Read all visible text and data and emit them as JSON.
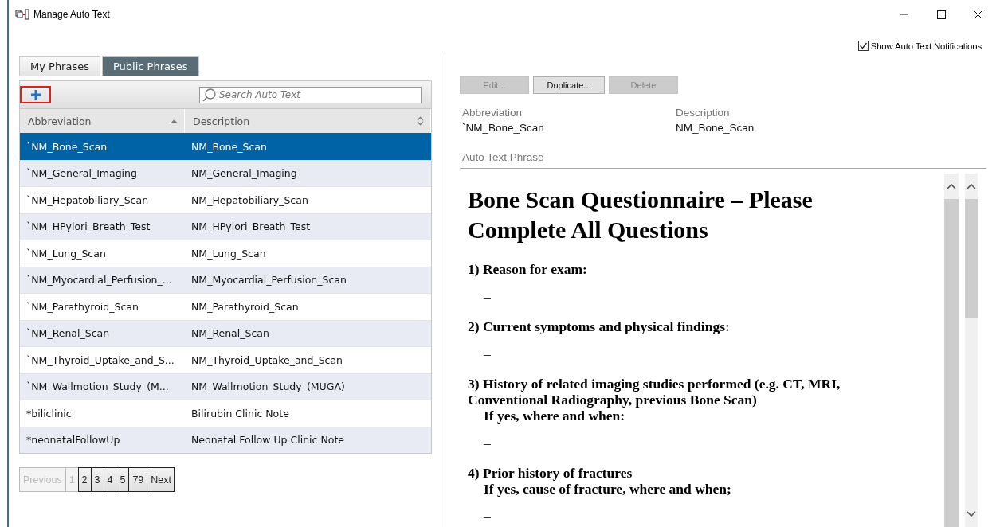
{
  "window": {
    "title": "Manage Auto Text"
  },
  "notifications": {
    "label": "Show Auto Text Notifications",
    "checked": true
  },
  "tabs": [
    {
      "label": "My Phrases",
      "selected": false
    },
    {
      "label": "Public Phrases",
      "selected": true
    }
  ],
  "search": {
    "placeholder": "Search Auto Text"
  },
  "table": {
    "columns": [
      "Abbreviation",
      "Description"
    ],
    "rows": [
      {
        "abbreviation": "`NM_Bone_Scan",
        "description": "NM_Bone_Scan",
        "selected": true
      },
      {
        "abbreviation": "`NM_General_Imaging",
        "description": "NM_General_Imaging",
        "selected": false
      },
      {
        "abbreviation": "`NM_Hepatobiliary_Scan",
        "description": "NM_Hepatobiliary_Scan",
        "selected": false
      },
      {
        "abbreviation": "`NM_HPylori_Breath_Test",
        "description": "NM_HPylori_Breath_Test",
        "selected": false
      },
      {
        "abbreviation": "`NM_Lung_Scan",
        "description": "NM_Lung_Scan",
        "selected": false
      },
      {
        "abbreviation": "`NM_Myocardial_Perfusion_...",
        "description": "NM_Myocardial_Perfusion_Scan",
        "selected": false
      },
      {
        "abbreviation": "`NM_Parathyroid_Scan",
        "description": "NM_Parathyroid_Scan",
        "selected": false
      },
      {
        "abbreviation": "`NM_Renal_Scan",
        "description": "NM_Renal_Scan",
        "selected": false
      },
      {
        "abbreviation": "`NM_Thyroid_Uptake_and_S...",
        "description": "NM_Thyroid_Uptake_and_Scan",
        "selected": false
      },
      {
        "abbreviation": "`NM_Wallmotion_Study_(M...",
        "description": "NM_Wallmotion_Study_(MUGA)",
        "selected": false
      },
      {
        "abbreviation": "*biliclinic",
        "description": "Bilirubin Clinic Note",
        "selected": false
      },
      {
        "abbreviation": "*neonatalFollowUp",
        "description": "Neonatal Follow Up Clinic Note",
        "selected": false
      }
    ]
  },
  "pagination": [
    {
      "label": "Previous",
      "disabled": true
    },
    {
      "label": "1",
      "disabled": true
    },
    {
      "label": "2",
      "disabled": false
    },
    {
      "label": "3",
      "disabled": false
    },
    {
      "label": "4",
      "disabled": false
    },
    {
      "label": "5",
      "disabled": false
    },
    {
      "label": "79",
      "disabled": false
    },
    {
      "label": "Next",
      "disabled": false
    }
  ],
  "actions": [
    {
      "label": "Edit...",
      "disabled": true
    },
    {
      "label": "Duplicate...",
      "disabled": false
    },
    {
      "label": "Delete",
      "disabled": true
    }
  ],
  "details": {
    "abbreviation_label": "Abbreviation",
    "abbreviation": "`NM_Bone_Scan",
    "description_label": "Description",
    "description": "NM_Bone_Scan",
    "phrase_label": "Auto Text Phrase"
  },
  "document": {
    "title": "Bone Scan Questionnaire – Please Complete All Questions",
    "lines": [
      {
        "kind": "question",
        "text": "1) Reason for exam:"
      },
      {
        "kind": "answer",
        "text": "–"
      },
      {
        "kind": "question",
        "text": "2) Current symptoms and physical findings:"
      },
      {
        "kind": "answer",
        "text": "–"
      },
      {
        "kind": "question",
        "text": "3) History of related imaging studies performed (e.g. CT, MRI, Conventional Radiography, previous Bone Scan)"
      },
      {
        "kind": "sub",
        "text": "If yes, where and when:"
      },
      {
        "kind": "answer",
        "text": "–"
      },
      {
        "kind": "question",
        "text": "4) Prior history of fractures"
      },
      {
        "kind": "sub",
        "text": "If yes, cause of fracture, where and when;"
      },
      {
        "kind": "answer",
        "text": "–"
      }
    ]
  }
}
